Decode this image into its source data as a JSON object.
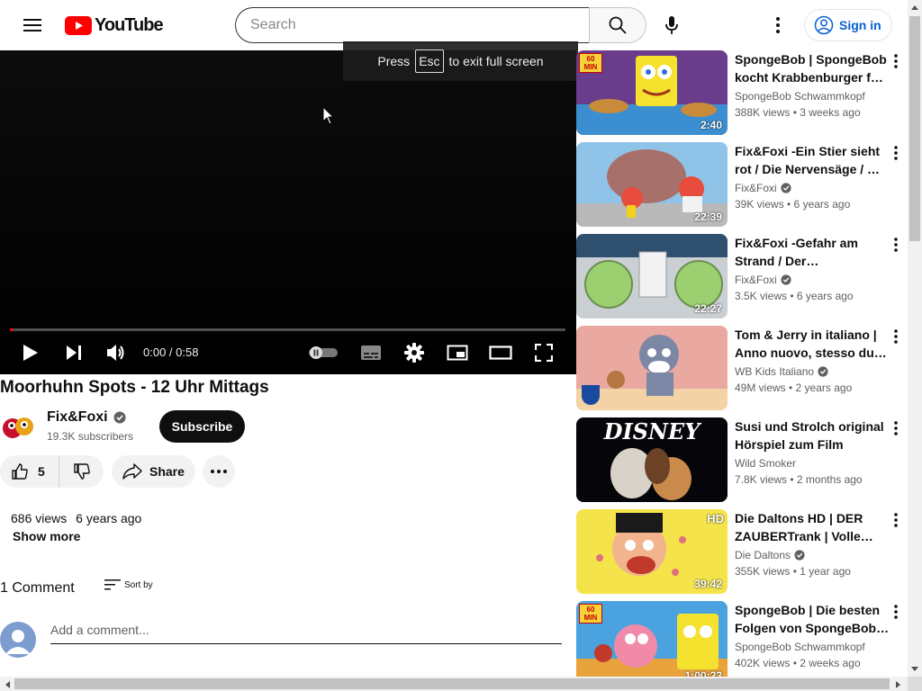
{
  "header": {
    "logo_text": "YouTube",
    "search_placeholder": "Search",
    "sign_in_label": "Sign in"
  },
  "fullscreen_hint": {
    "prefix": "Press",
    "key": "Esc",
    "suffix": "to exit full screen"
  },
  "player": {
    "time": "0:00 / 0:58",
    "progress_fraction": 0.0
  },
  "video": {
    "title": "Moorhuhn Spots - 12 Uhr Mittags",
    "channel_name": "Fix&Foxi",
    "subscribers": "19.3K subscribers",
    "subscribe_label": "Subscribe",
    "likes": "5",
    "share_label": "Share",
    "views": "686 views",
    "age": "6 years ago",
    "show_more_label": "Show more"
  },
  "comments": {
    "count_label": "1 Comment",
    "sort_label": "Sort by",
    "add_placeholder": "Add a comment..."
  },
  "recommendations": [
    {
      "title": "SpongeBob | SpongeBob kocht Krabbenburger für …",
      "channel": "SpongeBob Schwammkopf",
      "verified": false,
      "views": "388K views",
      "age": "3 weeks ago",
      "duration": "2:40",
      "badge": "60 MIN"
    },
    {
      "title": "Fix&Foxi -Ein Stier sieht rot / Die Nervensäge / …",
      "channel": "Fix&Foxi",
      "verified": true,
      "views": "39K views",
      "age": "6 years ago",
      "duration": "22:39",
      "badge": ""
    },
    {
      "title": "Fix&Foxi -Gefahr am Strand / Der…",
      "channel": "Fix&Foxi",
      "verified": true,
      "views": "3.5K views",
      "age": "6 years ago",
      "duration": "22:27",
      "badge": ""
    },
    {
      "title": "Tom & Jerry in italiano | Anno nuovo, stesso duo | …",
      "channel": "WB Kids Italiano",
      "verified": true,
      "views": "49M views",
      "age": "2 years ago",
      "duration": "",
      "badge": ""
    },
    {
      "title": "Susi und Strolch original Hörspiel zum Film",
      "channel": "Wild Smoker",
      "verified": false,
      "views": "7.8K views",
      "age": "2 months ago",
      "duration": "",
      "badge": ""
    },
    {
      "title": "Die Daltons HD | DER ZAUBERTrank | Volle…",
      "channel": "Die Daltons",
      "verified": true,
      "views": "355K views",
      "age": "1 year ago",
      "duration": "39:42",
      "badge": "HD"
    },
    {
      "title": "SpongeBob | Die besten Folgen von SpongeBob f…",
      "channel": "SpongeBob Schwammkopf",
      "verified": false,
      "views": "402K views",
      "age": "2 weeks ago",
      "duration": "1:00:23",
      "badge": "60 MIN"
    }
  ],
  "colors": {
    "brand_red": "#ff0000",
    "link_blue": "#065fd4",
    "text_primary": "#0f0f0f",
    "text_secondary": "#606060"
  }
}
